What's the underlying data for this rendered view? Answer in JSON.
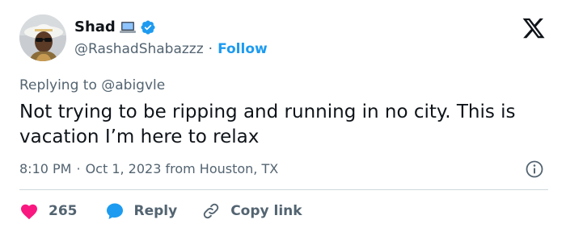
{
  "author": {
    "display_name": "Shad",
    "handle": "@RashadShabazzz",
    "follow_label": "Follow",
    "separator": "·",
    "verified_color": "#1d9bf0"
  },
  "reply_context": {
    "prefix": "Replying to",
    "mention": "@abigvle"
  },
  "tweet": {
    "text": "Not trying to be ripping and running in no city. This is vacation I’m here to relax",
    "time": "8:10 PM",
    "separator": "·",
    "date_location": "Oct 1, 2023 from Houston, TX"
  },
  "actions": {
    "like_count": "265",
    "reply_label": "Reply",
    "copy_link_label": "Copy link"
  },
  "icons": {
    "avatar": "avatar",
    "laptop": "laptop-icon",
    "verified": "verified-badge-icon",
    "brand": "x-logo-icon",
    "info": "info-icon",
    "like": "heart-icon",
    "reply": "reply-bubble-icon",
    "copy": "link-icon"
  },
  "colors": {
    "accent": "#1d9bf0",
    "heart": "#f91880",
    "text": "#0f1419",
    "muted": "#536471",
    "divider": "#cfd9de"
  }
}
